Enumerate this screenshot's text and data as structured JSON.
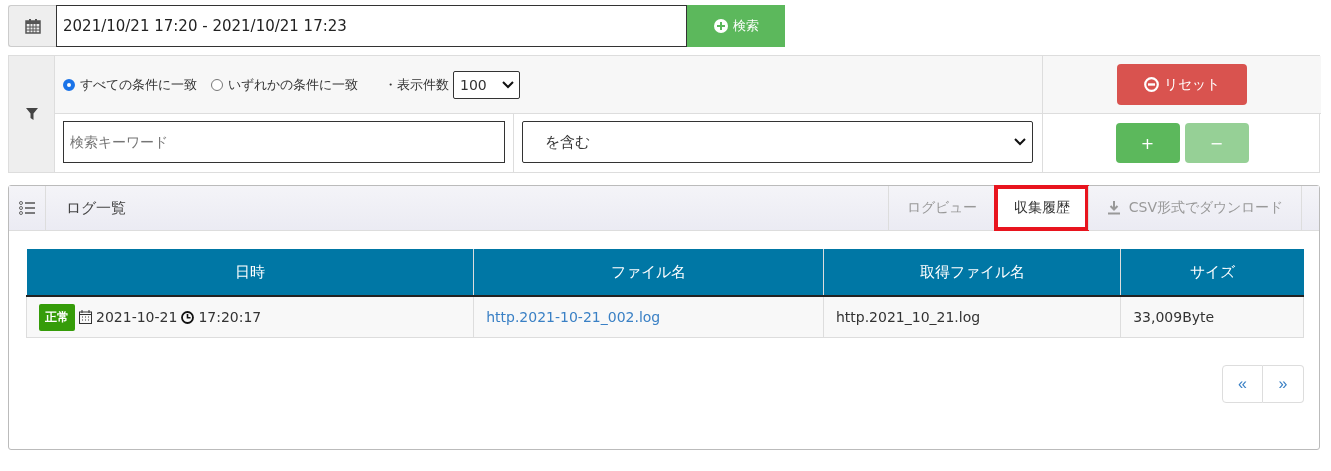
{
  "date_range": {
    "value": "2021/10/21 17:20 - 2021/10/21 17:23"
  },
  "search_button": {
    "label": "検索"
  },
  "filter": {
    "match_options": [
      {
        "label": "すべての条件に一致",
        "selected": true
      },
      {
        "label": "いずれかの条件に一致",
        "selected": false
      }
    ],
    "page_size_label": "・表示件数",
    "page_size": "100",
    "keyword": {
      "placeholder": "検索キーワード"
    },
    "condition": "を含む",
    "reset_button": "リセット",
    "add_button": {
      "label": "+",
      "disabled": false
    },
    "remove_button": {
      "label": "−",
      "disabled": true
    }
  },
  "panel": {
    "title": "ログ一覧",
    "tabs": [
      {
        "label": "ログビュー",
        "selected": false,
        "highlighted": false,
        "kind": "tab"
      },
      {
        "label": "収集履歴",
        "selected": true,
        "highlighted": true,
        "kind": "tab"
      },
      {
        "label": "CSV形式でダウンロード",
        "selected": false,
        "highlighted": false,
        "kind": "download"
      }
    ],
    "table": {
      "columns": [
        "日時",
        "ファイル名",
        "取得ファイル名",
        "サイズ"
      ],
      "rows": [
        {
          "status": "正常",
          "date": "2021-10-21",
          "time": "17:20:17",
          "file": "http.2021-10-21_002.log",
          "source_file": "http.2021_10_21.log",
          "size": "33,009Byte"
        }
      ]
    },
    "pagination": [
      "«",
      "»"
    ]
  }
}
